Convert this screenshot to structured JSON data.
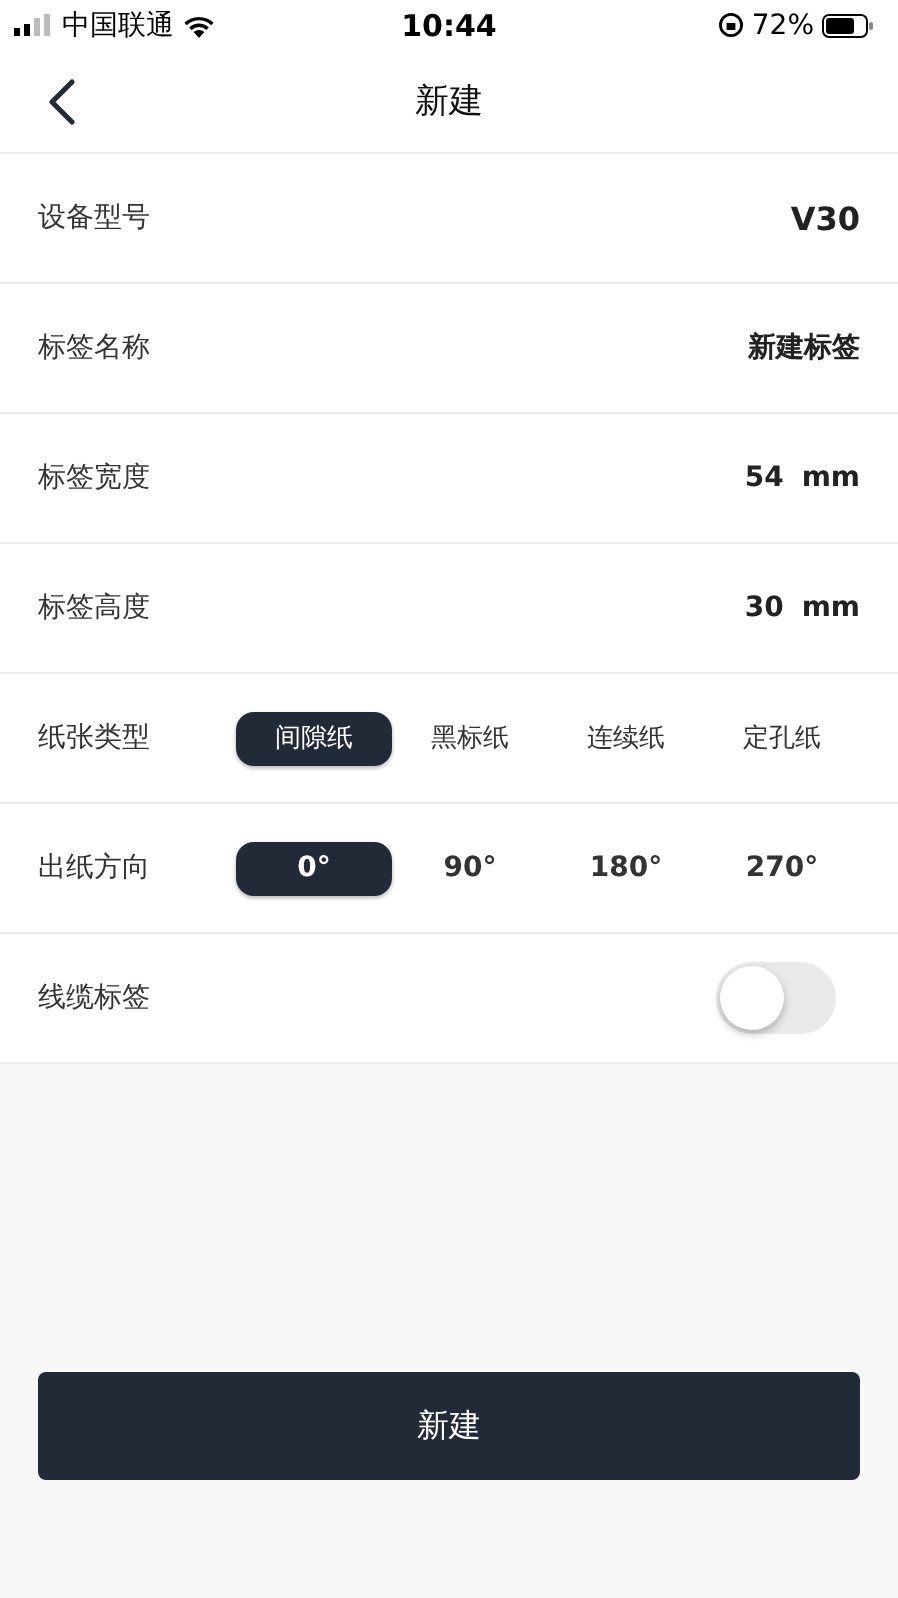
{
  "status_bar": {
    "carrier": "中国联通",
    "time": "10:44",
    "battery": "72%"
  },
  "nav": {
    "title": "新建"
  },
  "rows": [
    {
      "kind": "value",
      "label": "设备型号",
      "value": "V30"
    },
    {
      "kind": "value",
      "label": "标签名称",
      "value": "新建标签"
    },
    {
      "kind": "unit",
      "label": "标签宽度",
      "value": "54",
      "unit": "mm"
    },
    {
      "kind": "unit",
      "label": "标签高度",
      "value": "30",
      "unit": "mm"
    },
    {
      "kind": "segmented",
      "label": "纸张类型",
      "options": [
        {
          "label": "间隙纸",
          "selected": true
        },
        {
          "label": "黑标纸",
          "selected": false
        },
        {
          "label": "连续纸",
          "selected": false
        },
        {
          "label": "定孔纸",
          "selected": false
        }
      ]
    },
    {
      "kind": "segmented",
      "label": "出纸方向",
      "options": [
        {
          "label": "0°",
          "selected": true
        },
        {
          "label": "90°",
          "selected": false
        },
        {
          "label": "180°",
          "selected": false
        },
        {
          "label": "270°",
          "selected": false
        }
      ]
    },
    {
      "kind": "toggle",
      "label": "线缆标签",
      "on": false
    }
  ],
  "submit": {
    "label": "新建"
  }
}
